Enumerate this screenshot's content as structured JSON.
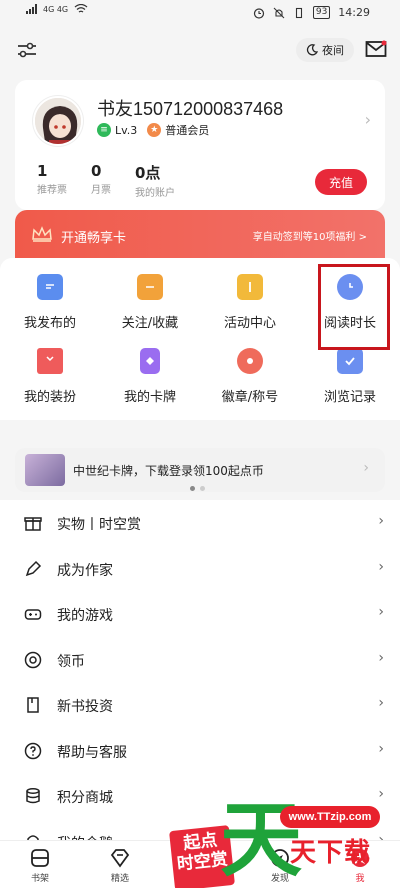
{
  "status_bar": {
    "left": "4G  4G",
    "battery": "93",
    "time": "14:29"
  },
  "topbar": {
    "night_label": "夜间"
  },
  "profile": {
    "username": "书友150712000837468",
    "level": "Lv.3",
    "membership": "普通会员",
    "stats": [
      {
        "num": "1",
        "label": "推荐票"
      },
      {
        "num": "0",
        "label": "月票"
      },
      {
        "num": "0点",
        "label": "我的账户"
      }
    ],
    "recharge_label": "充值"
  },
  "vip": {
    "title": "开通畅享卡",
    "perks": "享自动签到等10项福利 >"
  },
  "grid": [
    {
      "label": "我发布的",
      "icon": "message-icon",
      "color": "#5b8def"
    },
    {
      "label": "关注/收藏",
      "icon": "folder-icon",
      "color": "#f2a23a"
    },
    {
      "label": "活动中心",
      "icon": "gift-icon",
      "color": "#f2b93a"
    },
    {
      "label": "阅读时长",
      "icon": "clock-icon",
      "color": "#6b8ff0"
    },
    {
      "label": "我的装扮",
      "icon": "shirt-icon",
      "color": "#ef5b5b"
    },
    {
      "label": "我的卡牌",
      "icon": "card-icon",
      "color": "#9a6df0"
    },
    {
      "label": "徽章/称号",
      "icon": "medal-icon",
      "color": "#ef6b5b"
    },
    {
      "label": "浏览记录",
      "icon": "history-icon",
      "color": "#6b8ff0"
    }
  ],
  "promo": {
    "text": "中世纪卡牌，下载登录领100起点币"
  },
  "menu": [
    {
      "label": "实物丨时空赏",
      "icon": "gift-box-icon"
    },
    {
      "label": "成为作家",
      "icon": "pen-icon"
    },
    {
      "label": "我的游戏",
      "icon": "gamepad-icon"
    },
    {
      "label": "领币",
      "icon": "coin-icon"
    },
    {
      "label": "新书投资",
      "icon": "bookmark-icon"
    },
    {
      "label": "帮助与客服",
      "icon": "help-icon"
    },
    {
      "label": "积分商城",
      "icon": "database-icon"
    },
    {
      "label": "我的企鹅",
      "icon": "penguin-icon"
    }
  ],
  "tabs": [
    {
      "label": "书架",
      "icon": "bookshelf-icon"
    },
    {
      "label": "精选",
      "icon": "diamond-icon"
    },
    {
      "label": "",
      "icon": "star-icon"
    },
    {
      "label": "发现",
      "icon": "compass-icon"
    },
    {
      "label": "我",
      "icon": "profile-icon"
    }
  ],
  "watermark": {
    "site": "www.TTzip.com",
    "big": "天",
    "text": "天下载",
    "qidian_line1": "起点",
    "qidian_line2": "时空赏"
  }
}
